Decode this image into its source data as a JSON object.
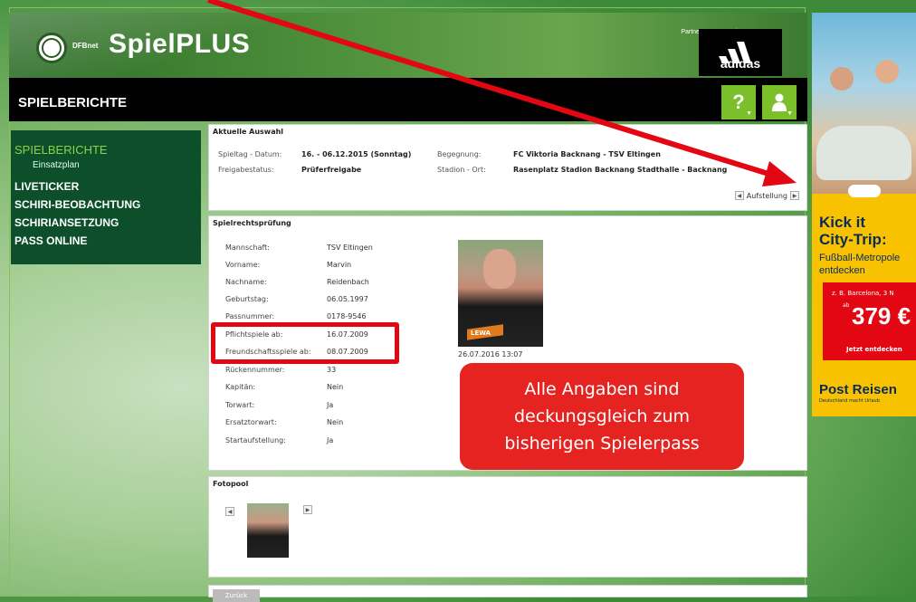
{
  "header": {
    "logo_small": "DFBnet",
    "logo_main": "SpielPLUS",
    "partner": "Partner DFBnet und FUSSBALL.DE",
    "sponsor": "adidas"
  },
  "titlebar": {
    "title": "SPIELBERICHTE",
    "help_button": "?",
    "user_button": "person-icon"
  },
  "sidebar": {
    "items": [
      {
        "label": "SPIELBERICHTE",
        "active": true
      },
      {
        "label": "Einsatzplan",
        "sub": true
      },
      {
        "label": "LIVETICKER"
      },
      {
        "label": "SCHIRI-BEOBACHTUNG"
      },
      {
        "label": "SCHIRIANSETZUNG"
      },
      {
        "label": "PASS ONLINE"
      }
    ]
  },
  "auswahl": {
    "title": "Aktuelle Auswahl",
    "spieltag_label": "Spieltag - Datum:",
    "spieltag_value": "16. - 06.12.2015 (Sonntag)",
    "freigabe_label": "Freigabestatus:",
    "freigabe_value": "Prüferfreigabe",
    "begegnung_label": "Begegnung:",
    "begegnung_value": "FC Viktoria Backnang - TSV Eltingen",
    "stadion_label": "Stadion - Ort:",
    "stadion_value": "Rasenplatz Stadion Backnang Stadthalle - Backnang",
    "aufstellung_label": "Aufstellung"
  },
  "spielrecht": {
    "title": "Spielrechtsprüfung",
    "rows": [
      {
        "label": "Mannschaft:",
        "value": "TSV Eltingen"
      },
      {
        "label": "Vorname:",
        "value": "Marvin"
      },
      {
        "label": "Nachname:",
        "value": "Reidenbach"
      },
      {
        "label": "Geburtstag:",
        "value": "06.05.1997"
      },
      {
        "label": "Passnummer:",
        "value": "0178-9546"
      },
      {
        "label": "Pflichtspiele ab:",
        "value": "16.07.2009"
      },
      {
        "label": "Freundschaftsspiele ab:",
        "value": "08.07.2009"
      },
      {
        "label": "Rückennummer:",
        "value": "33"
      },
      {
        "label": "Kapitän:",
        "value": "Nein"
      },
      {
        "label": "Torwart:",
        "value": "Ja"
      },
      {
        "label": "Ersatztorwart:",
        "value": "Nein"
      },
      {
        "label": "Startaufstellung:",
        "value": "Ja"
      }
    ],
    "photo_date": "26.07.2016 13:07",
    "photo_shirt_text": "LEWA"
  },
  "callout": {
    "line1": "Alle Angaben sind",
    "line2": "deckungsgleich zum",
    "line3": "bisherigen Spielerpass"
  },
  "fotopool": {
    "title": "Fotopool"
  },
  "bottom": {
    "back_button": "Zurück"
  },
  "ad": {
    "title_line1": "Kick it",
    "title_line2": "City-Trip:",
    "sub_line1": "Fußball-Metropole",
    "sub_line2": "entdecken",
    "offer_small": "z. B. Barcelona, 3 N",
    "offer_ab": "ab",
    "offer_price": "379 €",
    "offer_cta": "Jetzt entdecken",
    "brand": "Post Reisen",
    "brand_sub": "Deutschland macht Urlaub"
  },
  "colors": {
    "accent_green": "#7bbf2a",
    "sidebar_bg": "#0c4f2a",
    "callout_red": "#e52421",
    "highlight_red": "#e30613",
    "ad_yellow": "#f8c200"
  }
}
